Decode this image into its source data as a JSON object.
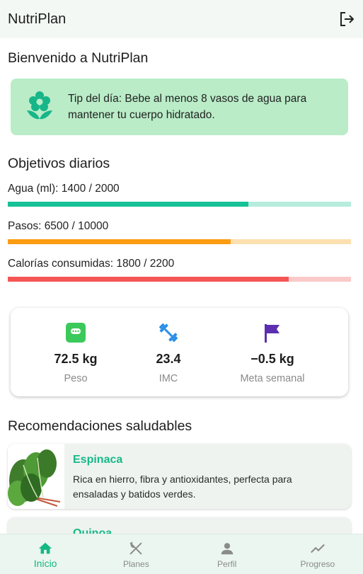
{
  "app": {
    "title": "NutriPlan"
  },
  "welcome": {
    "title": "Bienvenido a NutriPlan"
  },
  "tip": {
    "icon": "flower-icon",
    "text": "Tip del día: Bebe al menos 8 vasos de agua para mantener tu cuerpo hidratado."
  },
  "goals": {
    "title": "Objetivos diarios",
    "items": [
      {
        "label": "Agua (ml): 1400 / 2000",
        "current": 1400,
        "target": 2000,
        "color": "#16c297",
        "track": "#b5ecdc"
      },
      {
        "label": "Pasos: 6500 / 10000",
        "current": 6500,
        "target": 10000,
        "color": "#fb9c12",
        "track": "#fde0b0"
      },
      {
        "label": "Calorías consumidas: 1800 / 2200",
        "current": 1800,
        "target": 2200,
        "color": "#f45555",
        "track": "#fbc9c9"
      }
    ]
  },
  "stats": [
    {
      "icon": "scale-icon",
      "value": "72.5 kg",
      "label": "Peso",
      "color": "#3cc95c"
    },
    {
      "icon": "dumbbell-icon",
      "value": "23.4",
      "label": "IMC",
      "color": "#2b8fe8"
    },
    {
      "icon": "flag-icon",
      "value": "−0.5 kg",
      "label": "Meta semanal",
      "color": "#5b2fb0"
    }
  ],
  "recommendations": {
    "title": "Recomendaciones saludables",
    "items": [
      {
        "name": "Espinaca",
        "desc": "Rica en hierro, fibra y antioxidantes, perfecta para ensaladas y batidos verdes."
      },
      {
        "name": "Quinoa",
        "desc": ""
      }
    ]
  },
  "nav": [
    {
      "label": "Inicio",
      "icon": "home-icon",
      "active": true
    },
    {
      "label": "Planes",
      "icon": "utensils-icon",
      "active": false
    },
    {
      "label": "Perfil",
      "icon": "person-icon",
      "active": false
    },
    {
      "label": "Progreso",
      "icon": "trending-icon",
      "active": false
    }
  ],
  "colors": {
    "accent": "#14b884",
    "appbar": "#f3f8f5",
    "tip_bg": "#b9ecc7"
  }
}
